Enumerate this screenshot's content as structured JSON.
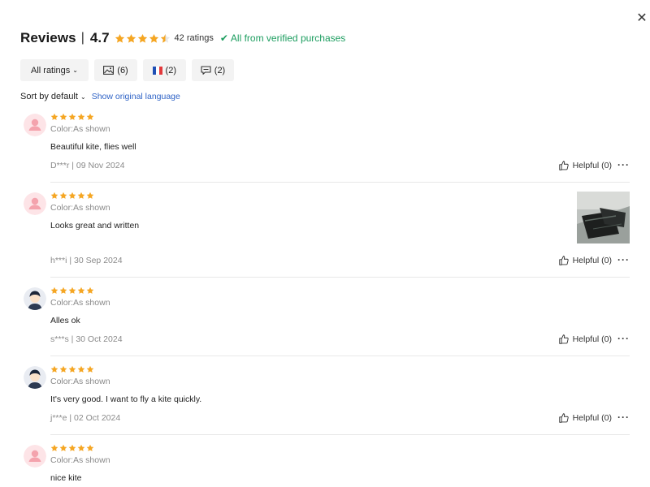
{
  "header": {
    "title": "Reviews",
    "separator": "|",
    "score": "4.7",
    "ratings_count": "42 ratings",
    "verified": "All from verified purchases"
  },
  "filters": {
    "all_ratings": "All ratings",
    "photos_count": "(6)",
    "flag_count": "(2)",
    "comments_count": "(2)"
  },
  "sort": {
    "label": "Sort by default",
    "original_language": "Show original language"
  },
  "colors": {
    "star": "#f5a623",
    "verified": "#1c9d5f",
    "link": "#2f63c6"
  },
  "reviews": [
    {
      "avatar": "pink-default-avatar",
      "stars": 5,
      "color": "Color:As shown",
      "text": "Beautiful kite, flies well",
      "meta": "D***r | 09 Nov 2024",
      "helpful": "Helpful (0)",
      "more": "···"
    },
    {
      "avatar": "pink-default-avatar",
      "stars": 5,
      "color": "Color:As shown",
      "text": "Looks great and written",
      "meta": "h***i | 30 Sep 2024",
      "helpful": "Helpful (0)",
      "more": "···",
      "has_photo": true
    },
    {
      "avatar": "dark-hair-avatar",
      "stars": 5,
      "color": "Color:As shown",
      "text": "Alles ok",
      "meta": "s***s | 30 Oct 2024",
      "helpful": "Helpful (0)",
      "more": "···"
    },
    {
      "avatar": "dark-hair-avatar",
      "stars": 5,
      "color": "Color:As shown",
      "text": "It's very good. I want to fly a kite quickly.",
      "meta": "j***e | 02 Oct 2024",
      "helpful": "Helpful (0)",
      "more": "···"
    },
    {
      "avatar": "pink-default-avatar",
      "stars": 5,
      "color": "Color:As shown",
      "text": "nice kite"
    }
  ]
}
